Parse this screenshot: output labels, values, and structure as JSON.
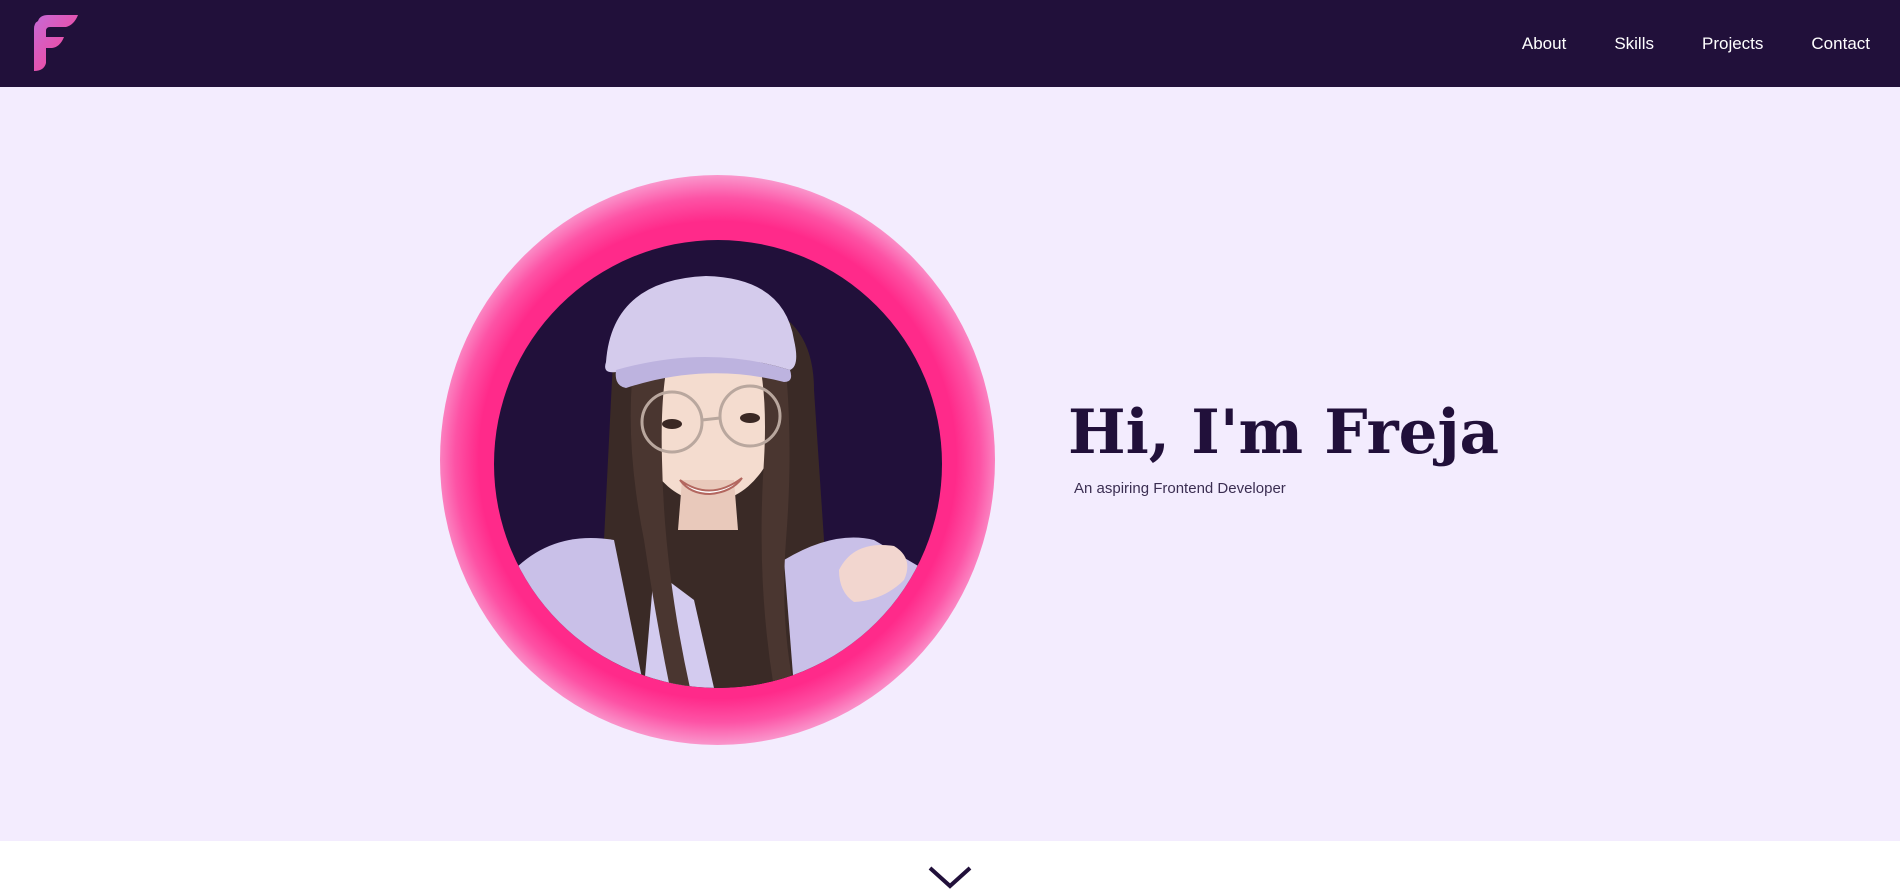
{
  "brand": {
    "logo_icon": "f-logo-icon",
    "colors": {
      "nav_bg": "#21103a",
      "hero_bg": "#f3ecfe",
      "accent": "#ff2a8a",
      "text_dark": "#21103a"
    }
  },
  "nav": {
    "items": [
      {
        "label": "About"
      },
      {
        "label": "Skills"
      },
      {
        "label": "Projects"
      },
      {
        "label": "Contact"
      }
    ]
  },
  "hero": {
    "greeting": "Hi, I'm Freja",
    "tagline": "An aspiring Frontend Developer",
    "portrait_icon": "profile-photo"
  },
  "scroll": {
    "icon": "chevron-down-icon"
  }
}
